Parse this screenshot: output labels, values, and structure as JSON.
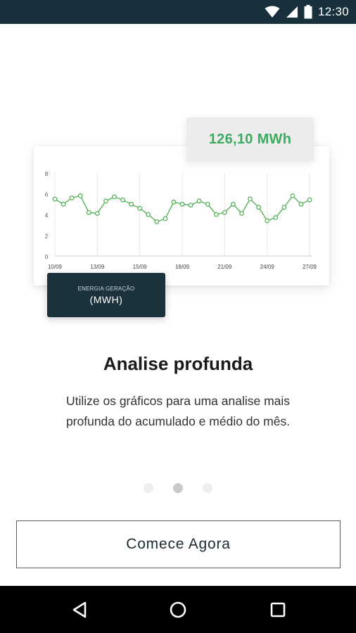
{
  "status_bar": {
    "time": "12:30",
    "icons": [
      "wifi-icon",
      "signal-icon",
      "battery-icon"
    ]
  },
  "illustration": {
    "value_card": "126,10 MWh",
    "label_card": {
      "small": "ENERGIA GERAÇÃO",
      "big": "(MWH)"
    }
  },
  "chart_data": {
    "type": "line",
    "x_labels": [
      "10/09",
      "13/09",
      "15/09",
      "18/09",
      "21/09",
      "24/09",
      "27/09"
    ],
    "y_ticks": [
      0,
      2,
      4,
      6,
      8
    ],
    "ylim": [
      0,
      8
    ],
    "grid": true,
    "series_color": "#4caf50",
    "values": [
      5.5,
      5.0,
      5.6,
      5.8,
      4.2,
      4.1,
      5.3,
      5.7,
      5.4,
      5.0,
      4.6,
      4.0,
      3.3,
      3.6,
      5.2,
      5.0,
      4.9,
      5.3,
      5.0,
      4.0,
      4.2,
      5.0,
      4.1,
      5.5,
      4.7,
      3.4,
      3.7,
      4.7,
      5.8,
      5.0,
      5.4
    ]
  },
  "onboarding": {
    "title": "Analise profunda",
    "description": "Utilize os gráficos para uma analise mais profunda do acumulado e médio do mês."
  },
  "pager": {
    "count": 3,
    "active_index": 1
  },
  "cta": {
    "label": "Comece Agora"
  },
  "nav_bar": {
    "buttons": [
      "back-icon",
      "home-icon",
      "recents-icon"
    ]
  }
}
